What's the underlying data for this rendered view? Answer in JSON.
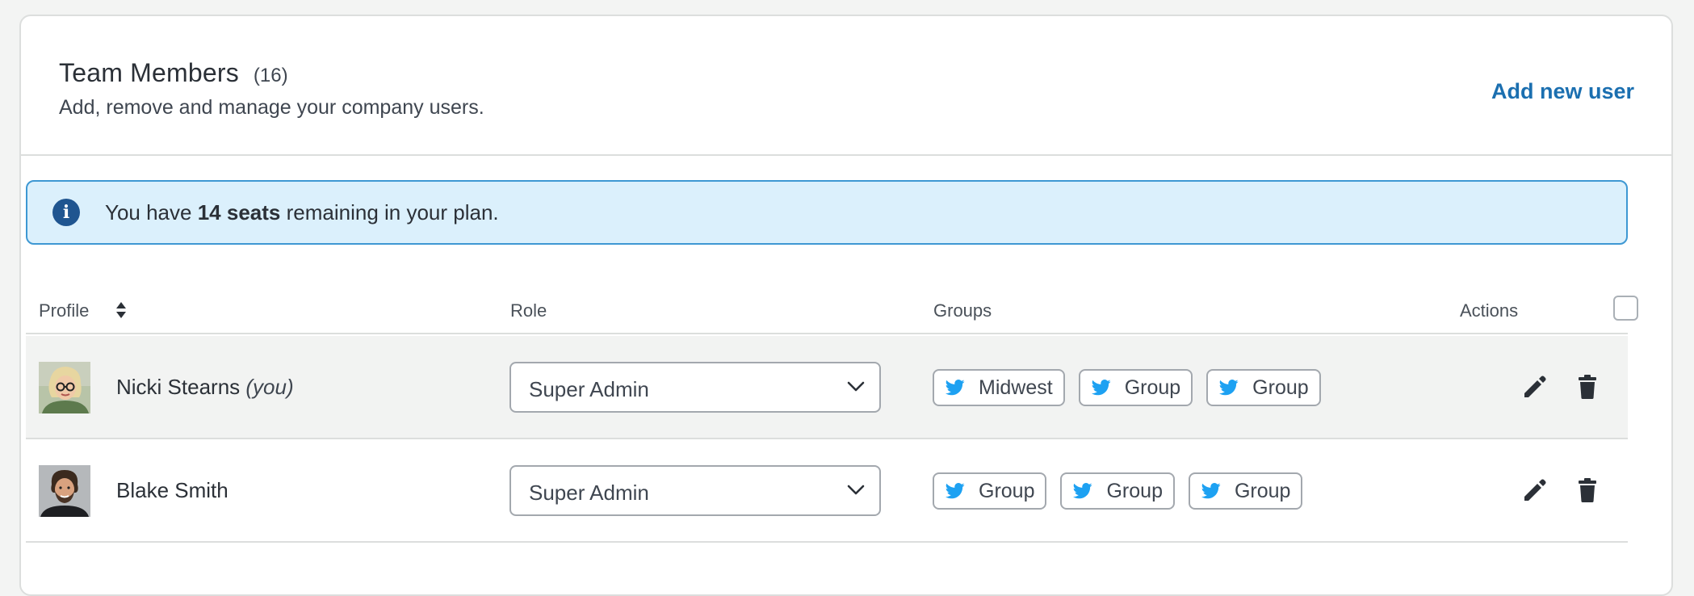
{
  "header": {
    "title": "Team Members",
    "count": "(16)",
    "subtitle": "Add, remove and manage your company users.",
    "add_user_label": "Add new user"
  },
  "banner": {
    "prefix": "You have",
    "emphasis": "14 seats",
    "suffix": "remaining in your plan.",
    "icon": "info-circle-icon",
    "icon_glyph": "i"
  },
  "table": {
    "columns": {
      "profile": "Profile",
      "role": "Role",
      "groups": "Groups",
      "actions": "Actions"
    },
    "rows": [
      {
        "name": "Nicki Stearns",
        "suffix": "(you)",
        "role": "Super Admin",
        "groups": [
          "Midwest",
          "Group",
          "Group"
        ],
        "shaded": true
      },
      {
        "name": "Blake Smith",
        "suffix": "",
        "role": "Super Admin",
        "groups": [
          "Group",
          "Group",
          "Group"
        ],
        "shaded": false
      }
    ]
  },
  "colors": {
    "accent": "#1b6fb0",
    "banner_bg": "#dbf0fc",
    "banner_border": "#3e98d3",
    "info_icon": "#1f5590",
    "twitter": "#1da1f2",
    "icon_dark": "#2b3037"
  }
}
